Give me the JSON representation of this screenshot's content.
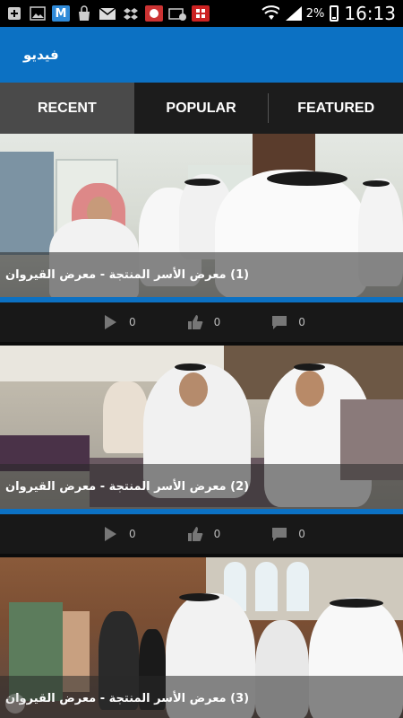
{
  "status_bar": {
    "battery_percent": "2%",
    "time": "16:13",
    "icons": [
      "add-box-icon",
      "image-icon",
      "m-app-icon",
      "bag-app-icon",
      "gmail-icon",
      "dropbox-icon",
      "app-icon",
      "mail-blocked-icon",
      "app-badge-icon",
      "wifi-icon",
      "signal-icon",
      "battery-icon"
    ]
  },
  "app_bar": {
    "title": "فيديو",
    "color": "#0c71c3"
  },
  "tabs": [
    {
      "label": "RECENT",
      "active": true
    },
    {
      "label": "POPULAR",
      "active": false
    },
    {
      "label": "FEATURED",
      "active": false
    }
  ],
  "videos": [
    {
      "title": "(1) معرض الأسر المنتجة - معرض القيروان",
      "plays": "0",
      "likes": "0",
      "comments": "0"
    },
    {
      "title": "(2) معرض الأسر المنتجة - معرض القيروان",
      "plays": "0",
      "likes": "0",
      "comments": "0"
    },
    {
      "title": "(3) معرض الأسر المنتجة - معرض القيروان"
    }
  ],
  "icons": {
    "play": "play-icon",
    "like": "thumbs-up-icon",
    "comment": "comment-icon"
  }
}
